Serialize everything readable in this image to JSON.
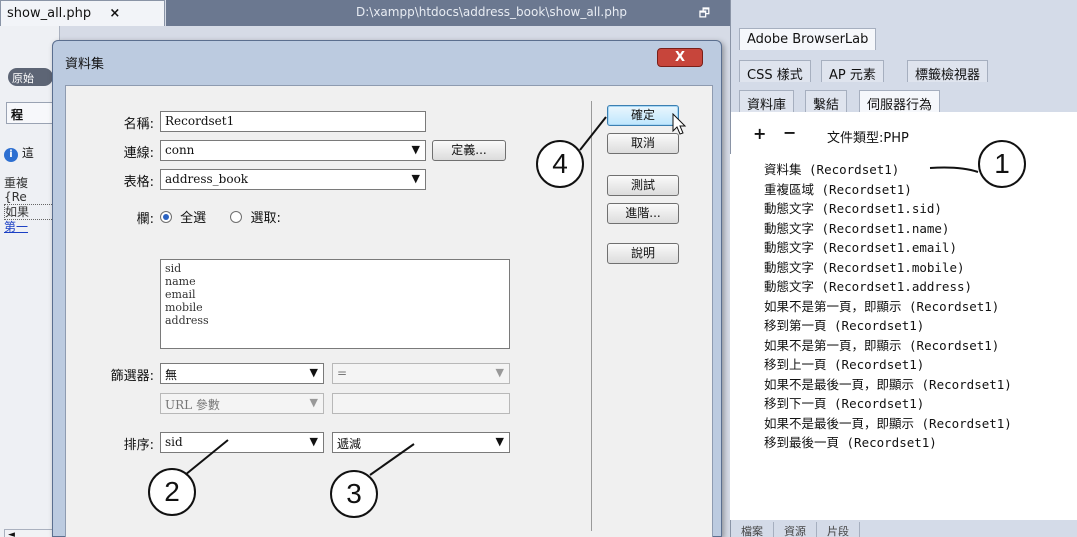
{
  "editor": {
    "tab_title": "show_all.php",
    "tab_close": "×",
    "path": "D:\\xampp\\htdocs\\address_book\\show_all.php",
    "restore": "🗗",
    "pill": "原始",
    "toolbar_char": "程",
    "info_icon": "i",
    "info_char": "這",
    "code_lines": [
      "重複",
      "{Re",
      "如果",
      "第一"
    ],
    "hscroll": "◄"
  },
  "dialog": {
    "title": "資料集",
    "close": "X",
    "name_label": "名稱:",
    "name_value": "Recordset1",
    "connection_label": "連線:",
    "connection_value": "conn",
    "define_button": "定義...",
    "table_label": "表格:",
    "table_value": "address_book",
    "columns_label": "欄:",
    "radio_all": "全選",
    "radio_select": "選取:",
    "columns": [
      "sid",
      "name",
      "email",
      "mobile",
      "address"
    ],
    "filter_label": "篩選器:",
    "filter_value": "無",
    "filter_op": "=",
    "filter_param": "URL 參數",
    "sort_label": "排序:",
    "sort_field": "sid",
    "sort_order": "遞減",
    "buttons": {
      "ok": "確定",
      "cancel": "取消",
      "test": "測試",
      "advanced": "進階...",
      "help": "說明"
    }
  },
  "panels": {
    "app_tab": "Adobe BrowserLab",
    "row2_tabs": [
      "CSS 樣式",
      "AP 元素",
      "標籤檢視器"
    ],
    "row3_tabs": [
      "資料庫",
      "繫結",
      "伺服器行為"
    ],
    "plus": "+",
    "minus": "−",
    "doctype": "文件類型:PHP",
    "behaviors": [
      "資料集 (Recordset1)",
      "重複區域 (Recordset1)",
      "動態文字 (Recordset1.sid)",
      "動態文字 (Recordset1.name)",
      "動態文字 (Recordset1.email)",
      "動態文字 (Recordset1.mobile)",
      "動態文字 (Recordset1.address)",
      "如果不是第一頁，即顯示 (Recordset1)",
      "移到第一頁 (Recordset1)",
      "如果不是第一頁，即顯示 (Recordset1)",
      "移到上一頁 (Recordset1)",
      "如果不是最後一頁，即顯示 (Recordset1)",
      "移到下一頁 (Recordset1)",
      "如果不是最後一頁，即顯示 (Recordset1)",
      "移到最後一頁 (Recordset1)"
    ],
    "bottom_tabs": [
      "檔案",
      "資源",
      "片段"
    ]
  },
  "callouts": [
    "1",
    "2",
    "3",
    "4"
  ]
}
